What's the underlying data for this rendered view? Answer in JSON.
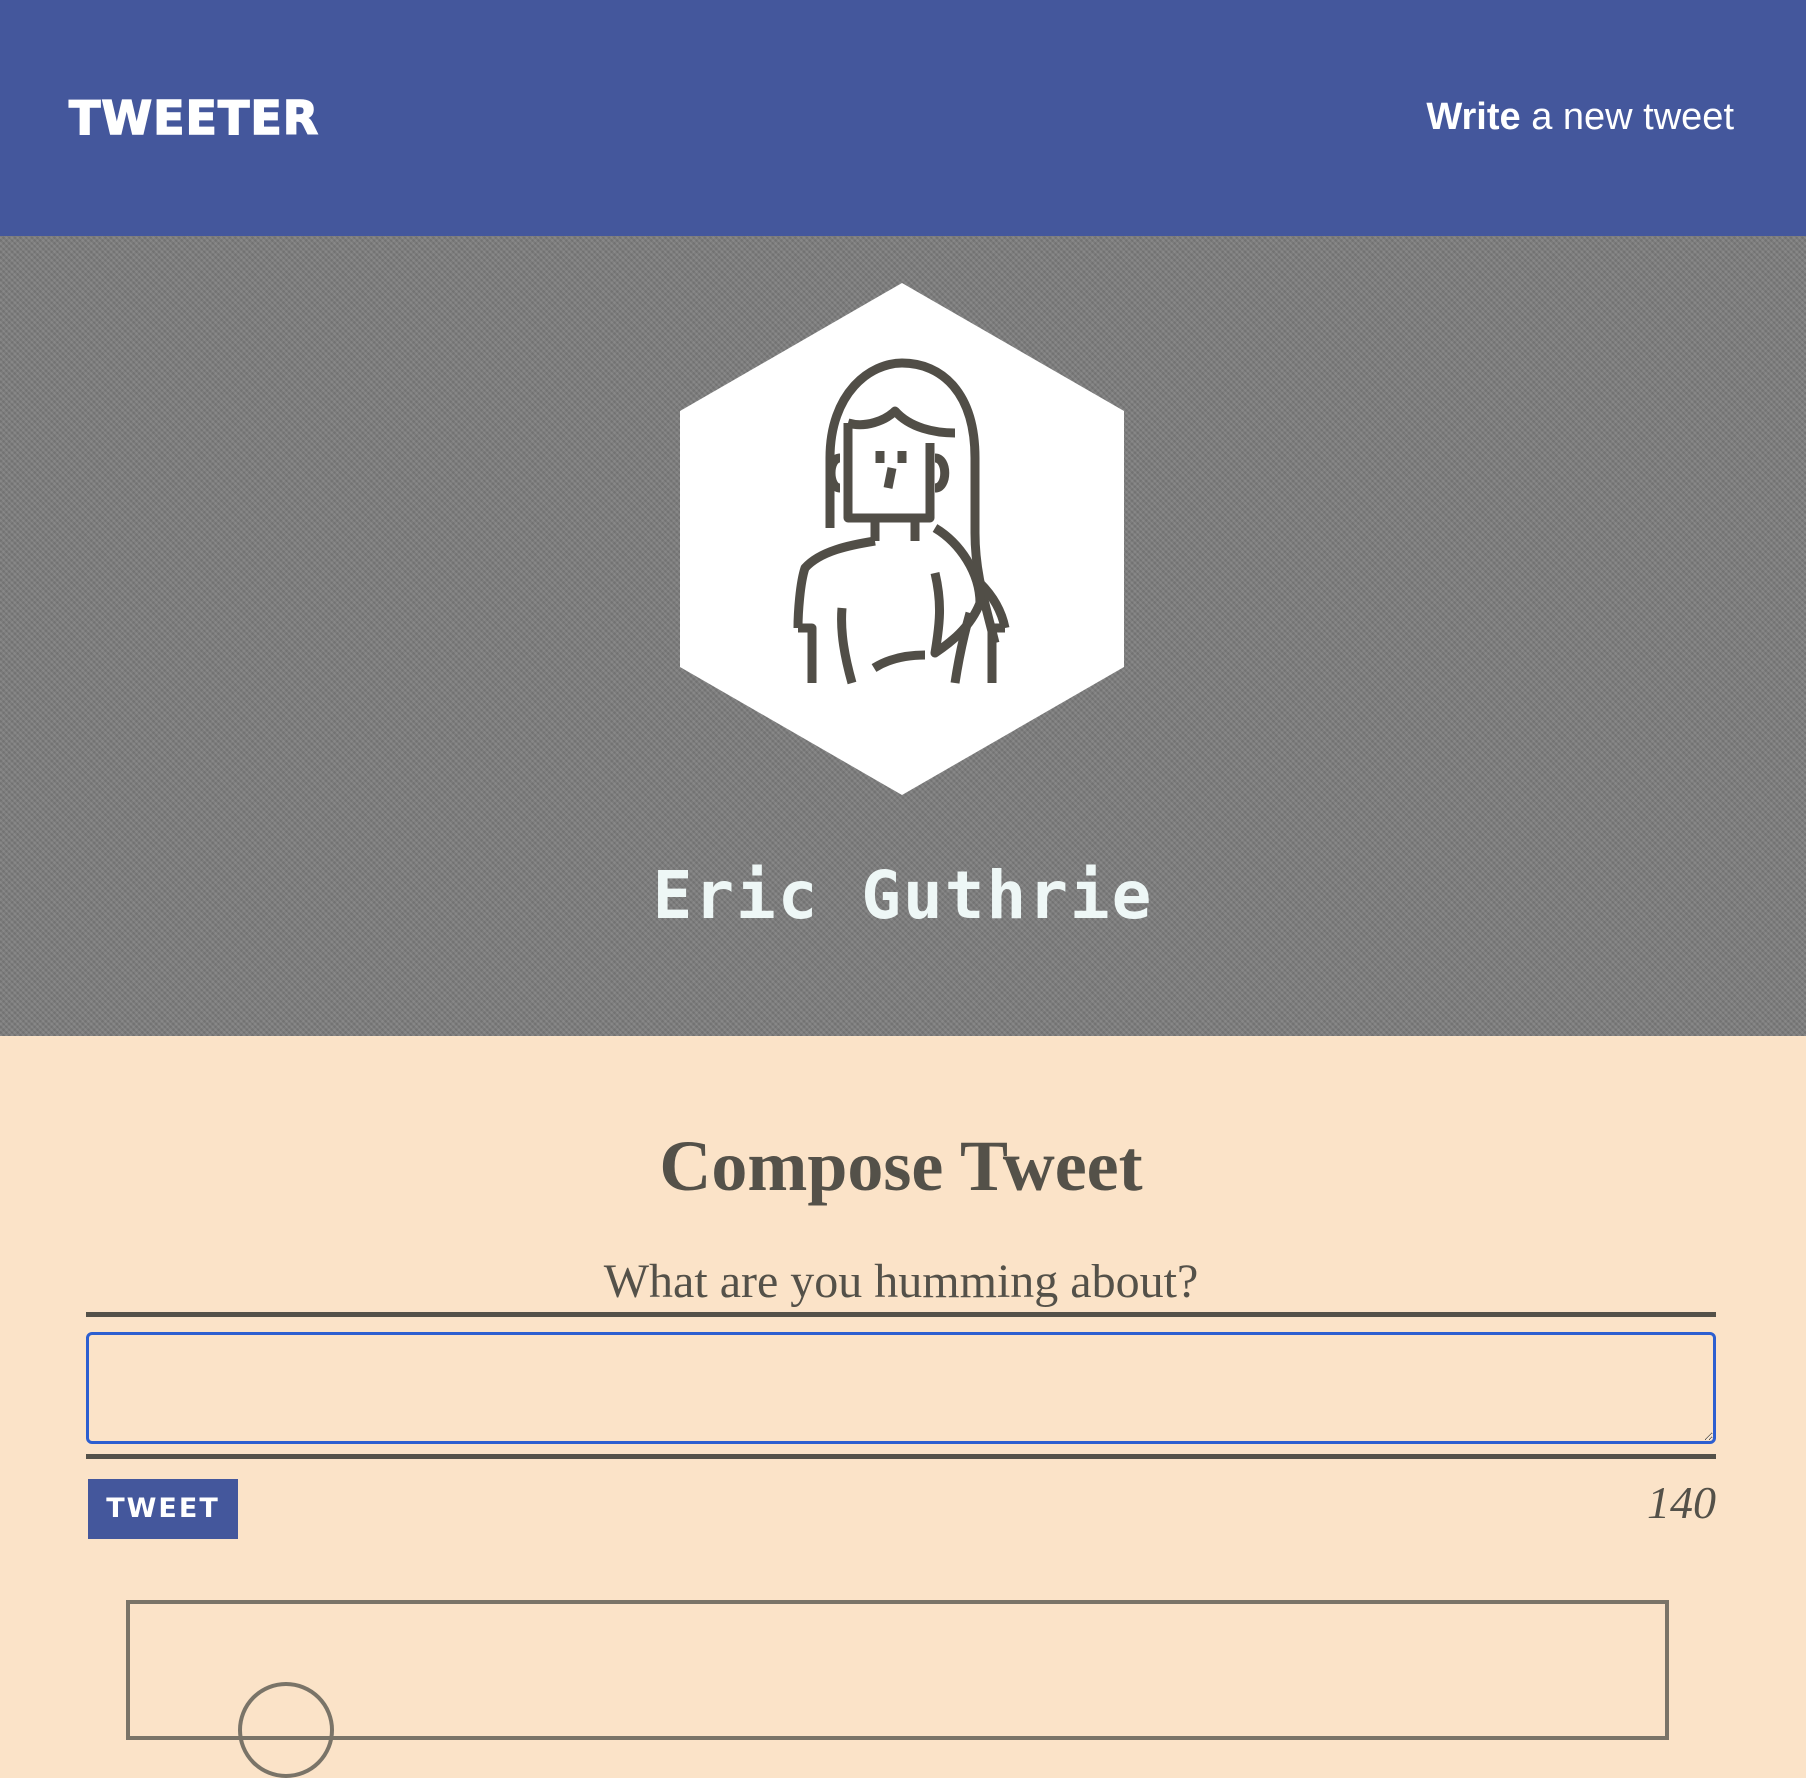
{
  "nav": {
    "brand": "TWEETER",
    "compose_link_strong": "Write",
    "compose_link_rest": " a new tweet"
  },
  "profile": {
    "name": "Eric Guthrie"
  },
  "compose": {
    "title": "Compose Tweet",
    "prompt": "What are you humming about?",
    "input_value": "",
    "input_placeholder": "",
    "submit_label": "TWEET",
    "char_count": "140"
  },
  "colors": {
    "nav_bg": "#44579c",
    "page_bg": "#fbe3c8",
    "profile_bg": "#7d7d7d",
    "text_dark": "#545149",
    "input_focus": "#2d5fd0"
  }
}
